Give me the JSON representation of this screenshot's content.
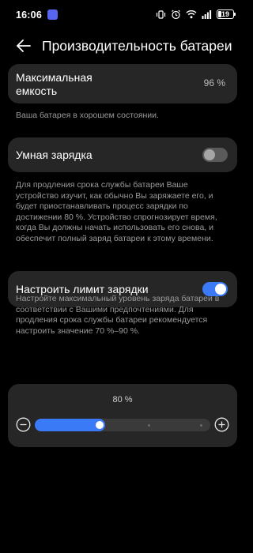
{
  "status_bar": {
    "time": "16:06",
    "battery_level": "19",
    "icons": [
      "discord-icon",
      "vibrate-icon",
      "alarm-icon",
      "wifi-icon",
      "signal-icon",
      "battery-icon"
    ]
  },
  "header": {
    "back_icon": "arrow-left-icon",
    "title": "Производительность батареи"
  },
  "capacity": {
    "label": "Максимальная емкость",
    "value": "96 %"
  },
  "health_note": "Ваша батарея в хорошем состоянии.",
  "smart_charging": {
    "label": "Умная зарядка",
    "enabled": false,
    "description": "Для продления срока службы батареи Ваше устройство изучит, как обычно Вы заряжаете его, и будет приостанавливать процесс зарядки по достижении 80 %. Устройство спрогнозирует время, когда Вы должны начать использовать его снова, и обеспечит полный заряд батареи к этому времени."
  },
  "charge_limit": {
    "label": "Настроить лимит зарядки",
    "enabled": true,
    "description": "Настройте максимальный уровень заряда батареи в соответствии с Вашими предпочтениями. Для продления срока службы батареи рекомендуется настроить значение 70 %–90 %."
  },
  "limit_slider": {
    "value_label": "80 %",
    "value": 80,
    "min": 80,
    "max": 100,
    "fill_fraction": 0.4,
    "minus_icon": "minus-circle-icon",
    "plus_icon": "plus-circle-icon"
  },
  "colors": {
    "accent": "#3b7af7",
    "card": "#262626",
    "background": "#000000",
    "secondary_text": "#9a9a9a"
  }
}
